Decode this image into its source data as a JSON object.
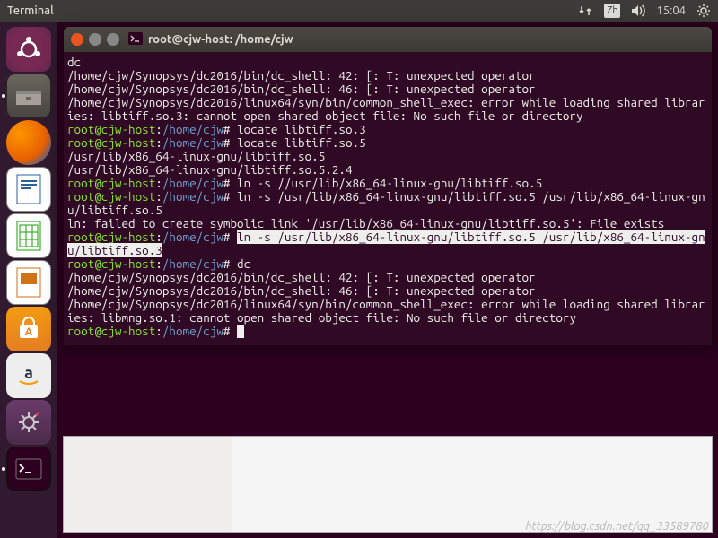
{
  "menubar": {
    "app_label": "Terminal",
    "ime_badge": "Zh",
    "clock": "15:04"
  },
  "termwindow": {
    "title": "root@cjw-host: /home/cjw"
  },
  "prompt": {
    "userhost": "root@cjw-host",
    "path": "/home/cjw",
    "sep": ":",
    "suffix": "# "
  },
  "term_lines": {
    "l01": "dc",
    "l02": "/home/cjw/Synopsys/dc2016/bin/dc_shell: 42: [: T: unexpected operator",
    "l03": "/home/cjw/Synopsys/dc2016/bin/dc_shell: 46: [: T: unexpected operator",
    "l04": "/home/cjw/Synopsys/dc2016/linux64/syn/bin/common_shell_exec: error while loading shared libraries: libtiff.so.3: cannot open shared object file: No such file or directory",
    "cmd1": "locate libtiff.so.3",
    "cmd2": "locate libtiff.so.5",
    "l07": "/usr/lib/x86_64-linux-gnu/libtiff.so.5",
    "l08": "/usr/lib/x86_64-linux-gnu/libtiff.so.5.2.4",
    "cmd3": "ln -s //usr/lib/x86_64-linux-gnu/libtiff.so.5",
    "cmd4": "ln -s /usr/lib/x86_64-linux-gnu/libtiff.so.5 /usr/lib/x86_64-linux-gnu/libtiff.so.5",
    "l11": "ln: failed to create symbolic link '/usr/lib/x86_64-linux-gnu/libtiff.so.5': File exists",
    "cmd5_hi": "ln -s /usr/lib/x86_64-linux-gnu/libtiff.so.5 /usr/lib/x86_64-linux-gnu/libtiff.so.3",
    "cmd6": "dc",
    "l14": "/home/cjw/Synopsys/dc2016/bin/dc_shell: 42: [: T: unexpected operator",
    "l15": "/home/cjw/Synopsys/dc2016/bin/dc_shell: 46: [: T: unexpected operator",
    "l16": "/home/cjw/Synopsys/dc2016/linux64/syn/bin/common_shell_exec: error while loading shared libraries: libmng.so.1: cannot open shared object file: No such file or directory"
  },
  "watermark": "https://blog.csdn.net/qq_33589780",
  "launcher_items": [
    "ubuntu-dash",
    "files",
    "firefox",
    "lo-writer",
    "lo-calc",
    "lo-impress",
    "ubuntu-software",
    "amazon",
    "settings",
    "terminal"
  ]
}
